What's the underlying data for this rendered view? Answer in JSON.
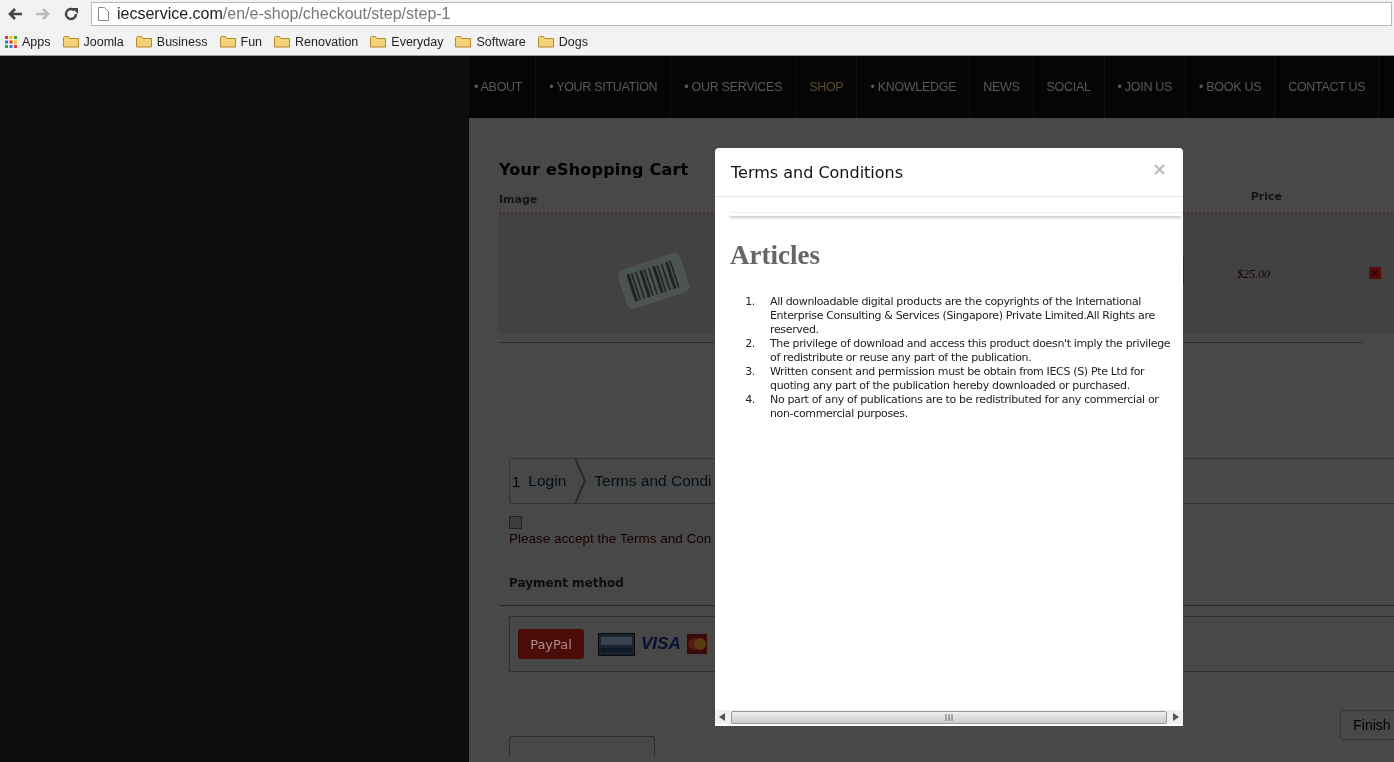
{
  "browser": {
    "back_disabled": false,
    "forward_disabled": true,
    "url_host": "iecservice.com",
    "url_path": "/en/e-shop/checkout/step/step-1",
    "bookmarks": [
      {
        "label": "Apps",
        "kind": "apps"
      },
      {
        "label": "Joomla",
        "kind": "folder"
      },
      {
        "label": "Business",
        "kind": "folder"
      },
      {
        "label": "Fun",
        "kind": "folder"
      },
      {
        "label": "Renovation",
        "kind": "folder"
      },
      {
        "label": "Everyday",
        "kind": "folder"
      },
      {
        "label": "Software",
        "kind": "folder"
      },
      {
        "label": "Dogs",
        "kind": "folder"
      }
    ]
  },
  "nav": [
    {
      "label": "• ABOUT",
      "selected": false
    },
    {
      "label": "• YOUR SITUATION",
      "selected": false
    },
    {
      "label": "• OUR SERVICES",
      "selected": false
    },
    {
      "label": "SHOP",
      "selected": true
    },
    {
      "label": "• KNOWLEDGE",
      "selected": false
    },
    {
      "label": "NEWS",
      "selected": false
    },
    {
      "label": "SOCIAL",
      "selected": false
    },
    {
      "label": "• JOIN US",
      "selected": false
    },
    {
      "label": "• BOOK US",
      "selected": false
    },
    {
      "label": "CONTACT US",
      "selected": false
    }
  ],
  "cart": {
    "title": "Your eShopping Cart",
    "columns": [
      "Image",
      "Price"
    ],
    "rows": [
      {
        "price": "$25.00"
      }
    ]
  },
  "checkout": {
    "steps": [
      {
        "number": "1",
        "label": "Login"
      },
      {
        "label": "Terms and Condi"
      }
    ],
    "terms_checkbox": {
      "checked": false
    },
    "terms_warning": "Please accept the Terms and Con",
    "payment_title": "Payment method",
    "paypal_button": "PayPal",
    "visa_logo": "VISA",
    "finish_button": "Finish"
  },
  "modal": {
    "title": "Terms and Conditions",
    "close": "×",
    "heading": "Articles",
    "items": [
      {
        "number": "1.",
        "text": "All downloadable digital products are the copyrights of the International Enterprise Consulting & Services (Singapore) Private Limited.All Rights are reserved."
      },
      {
        "number": "2.",
        "text": "The privilege of download and access this product doesn't imply the privilege of redistribute or reuse any part of the publication."
      },
      {
        "number": "3.",
        "text": "Written consent and permission must be obtain from IECS (S) Pte Ltd for quoting any part of the publication hereby downloaded or purchased."
      },
      {
        "number": "4.",
        "text": "No part of any of publications are to be redistributed for any commercial or non-commercial purposes."
      }
    ]
  }
}
